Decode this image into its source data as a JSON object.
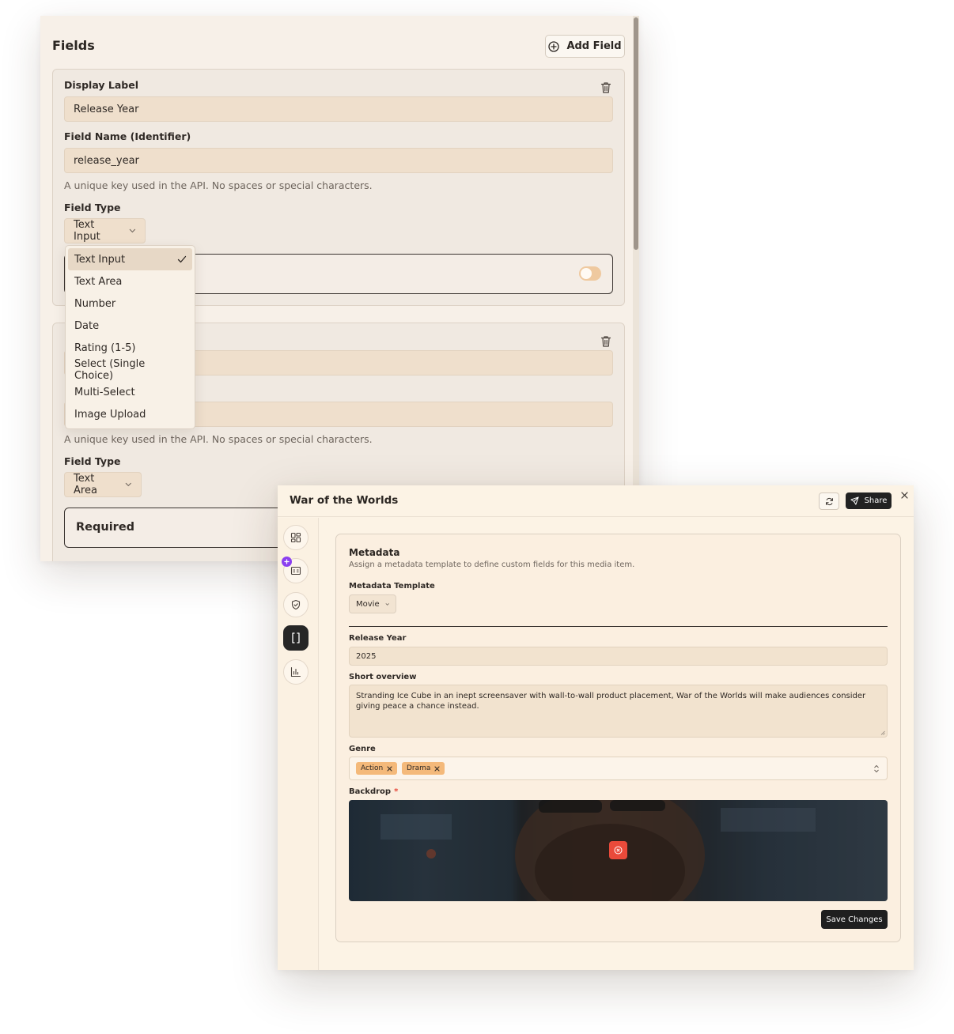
{
  "fields_panel": {
    "title": "Fields",
    "add_field_label": "Add Field",
    "card1": {
      "display_label_label": "Display Label",
      "display_label_value": "Release Year",
      "field_name_label": "Field Name (Identifier)",
      "field_name_value": "release_year",
      "help_text": "A unique key used in the API. No spaces or special characters.",
      "field_type_label": "Field Type",
      "field_type_value": "Text Input"
    },
    "card2": {
      "help_text": "A unique key used in the API. No spaces or special characters.",
      "field_type_label": "Field Type",
      "field_type_value": "Text Area",
      "required_label": "Required"
    },
    "dropdown": {
      "options": [
        "Text Input",
        "Text Area",
        "Number",
        "Date",
        "Rating (1-5)",
        "Select (Single Choice)",
        "Multi-Select",
        "Image Upload"
      ],
      "selected": "Text Input"
    }
  },
  "media_window": {
    "title": "War of the Worlds",
    "share_label": "Share",
    "sidebar_icons": [
      "grid-icon",
      "id-card-icon",
      "shield-check-icon",
      "brackets-icon",
      "bar-chart-icon"
    ],
    "active_sidebar": "brackets-icon",
    "metadata": {
      "title": "Metadata",
      "subtitle": "Assign a metadata template to define custom fields for this media item.",
      "template_label": "Metadata Template",
      "template_value": "Movie",
      "release_year_label": "Release Year",
      "release_year_value": "2025",
      "overview_label": "Short overview",
      "overview_value": "Stranding Ice Cube in an inept screensaver with wall-to-wall product placement, War of the Worlds will make audiences consider giving peace a chance instead.",
      "genre_label": "Genre",
      "genres": [
        "Action",
        "Drama"
      ],
      "backdrop_label": "Backdrop",
      "save_label": "Save Changes"
    }
  },
  "colors": {
    "accent_chip": "#f4b97a",
    "remove_button": "#e94a3a",
    "badge_purple": "#8b3ff0",
    "toggle_off": "#efc99f"
  }
}
